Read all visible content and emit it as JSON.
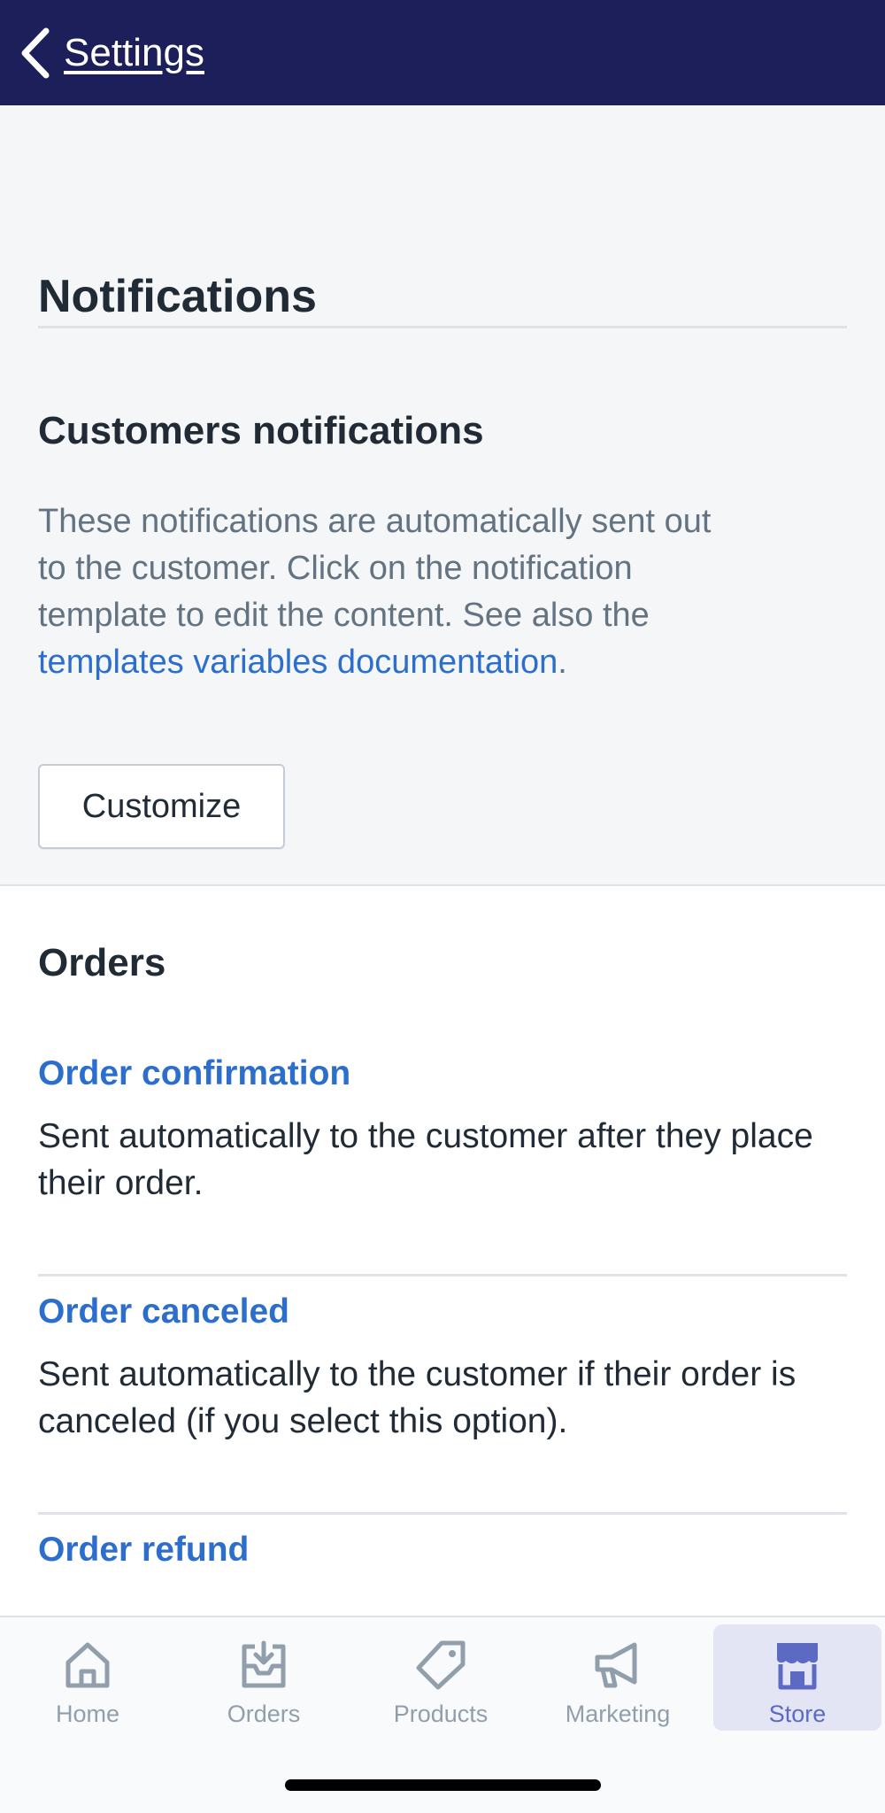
{
  "nav": {
    "back_label": "Settings"
  },
  "header": {
    "title": "Notifications",
    "section_title": "Customers notifications",
    "description_prefix": "These notifications are automatically sent out to the customer. Click on the notification template to edit the content. See also the ",
    "description_link": "templates variables documentation",
    "description_suffix": ".",
    "customize_label": "Customize"
  },
  "orders": {
    "title": "Orders",
    "items": [
      {
        "title": "Order confirmation",
        "description": "Sent automatically to the customer after they place their order."
      },
      {
        "title": "Order canceled",
        "description": "Sent automatically to the customer if their order is canceled (if you select this option)."
      },
      {
        "title": "Order refund"
      }
    ]
  },
  "tabbar": {
    "tabs": [
      {
        "label": "Home",
        "icon": "home-icon"
      },
      {
        "label": "Orders",
        "icon": "orders-icon"
      },
      {
        "label": "Products",
        "icon": "tag-icon"
      },
      {
        "label": "Marketing",
        "icon": "megaphone-icon"
      },
      {
        "label": "Store",
        "icon": "store-icon",
        "active": true
      }
    ]
  },
  "colors": {
    "nav_background": "#1c1f5a",
    "link": "#2c6ecb",
    "active_tab": "#5c6ac4",
    "active_tab_background": "#e3e5f5",
    "inactive_tab": "#919eab"
  }
}
